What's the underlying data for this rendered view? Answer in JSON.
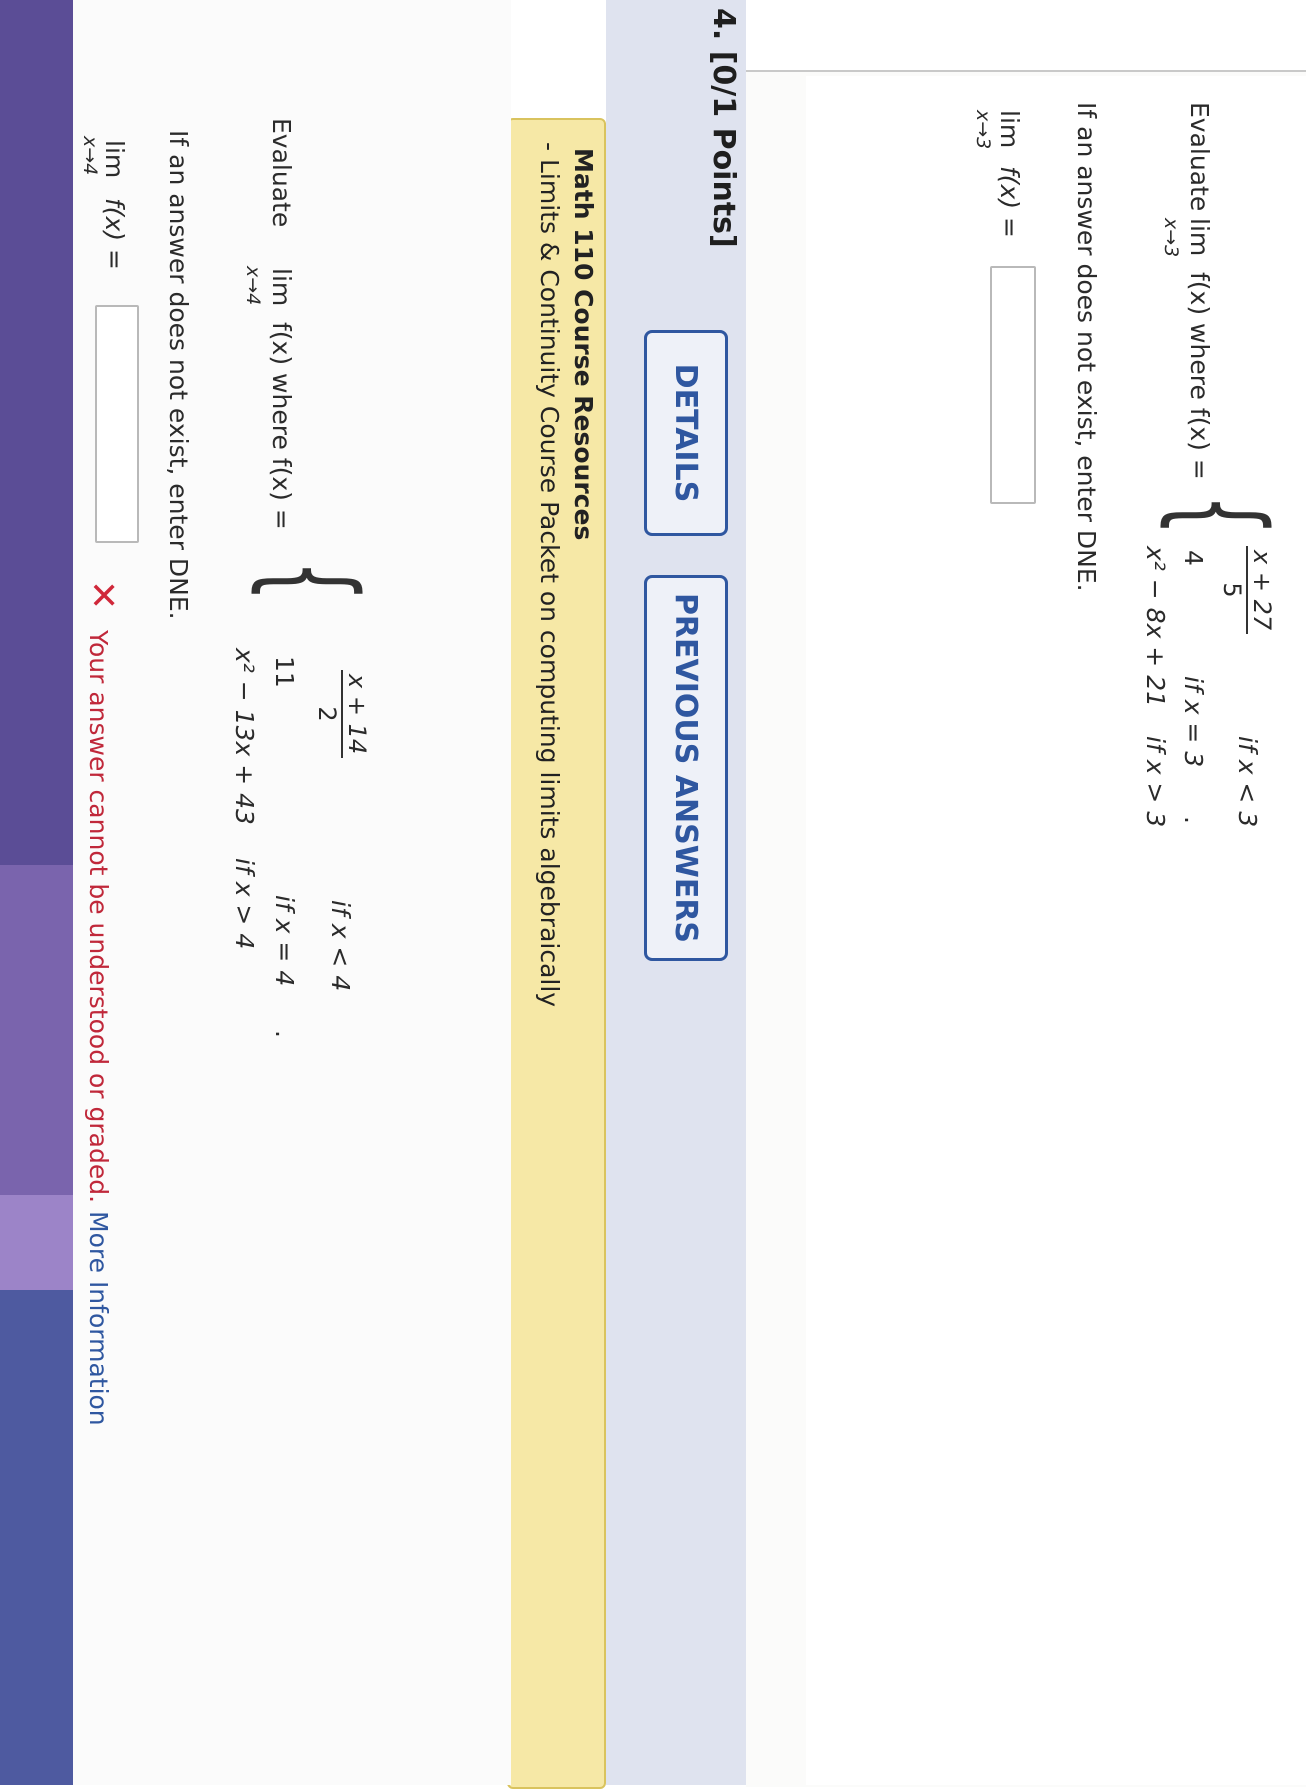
{
  "question3": {
    "evaluate_prefix": "Evaluate",
    "lim": "lim",
    "lim_sub": "x→3",
    "fx_where": "f(x) where f(x) =",
    "case1_num": "x + 27",
    "case1_den": "5",
    "case1_cond": "if x < 3",
    "case2_expr": "4",
    "case2_cond": "if x = 3",
    "case3_expr": "x² − 8x + 21",
    "case3_cond": "if x > 3",
    "period": ".",
    "dne_note": "If an answer does not exist, enter DNE.",
    "answer_lim": "lim",
    "answer_sub": "x→3",
    "answer_fx": "f(x) =",
    "answer_value": ""
  },
  "question4": {
    "title": "4.  [0/1 Points]",
    "details_button": "DETAILS",
    "previous_answers_button": "PREVIOUS ANSWERS",
    "resources_title": "Math 110 Course Resources",
    "resources_sub": "- Limits & Continuity Course Packet on computing limits algebraically",
    "evaluate_prefix": "Evaluate",
    "lim": "lim",
    "lim_sub": "x→4",
    "fx_where": "f(x) where f(x) =",
    "case1_num": "x + 14",
    "case1_den": "2",
    "case1_cond": "if x < 4",
    "case2_expr": "11",
    "case2_cond": "if x = 4",
    "case3_expr": "x² − 13x + 43",
    "case3_cond": "if x > 4",
    "period": ".",
    "dne_note": "If an answer does not exist, enter DNE.",
    "answer_lim": "lim",
    "answer_sub": "x→4",
    "answer_fx": "f(x) =",
    "answer_value": "",
    "error_message": "Your answer cannot be understood or graded.",
    "more_info_link": "More Information"
  },
  "colors": {
    "accent": "#2f57a0",
    "error": "#c0283a",
    "resources_bg": "#f6e8a6",
    "sidebar_purple": "#5b4d96"
  }
}
